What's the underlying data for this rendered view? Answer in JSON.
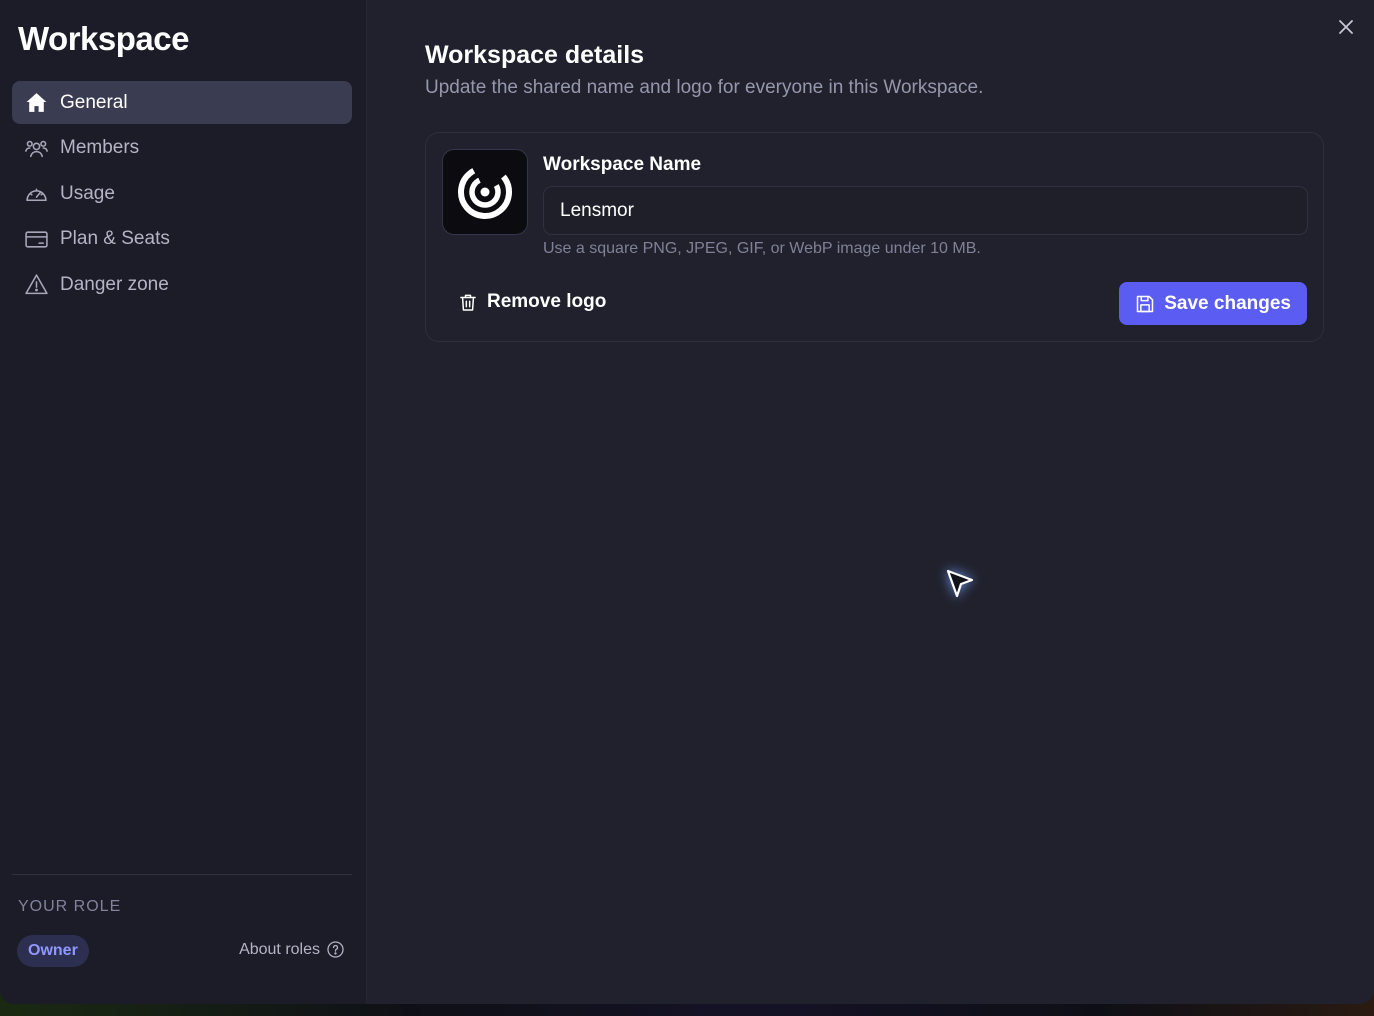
{
  "sidebar": {
    "title": "Workspace",
    "items": [
      {
        "label": "General",
        "icon": "home-icon",
        "active": true
      },
      {
        "label": "Members",
        "icon": "members-icon",
        "active": false
      },
      {
        "label": "Usage",
        "icon": "gauge-icon",
        "active": false
      },
      {
        "label": "Plan & Seats",
        "icon": "credit-card-icon",
        "active": false
      },
      {
        "label": "Danger zone",
        "icon": "warning-icon",
        "active": false
      }
    ],
    "role": {
      "label": "YOUR ROLE",
      "value": "Owner",
      "about_label": "About roles"
    }
  },
  "main": {
    "title": "Workspace details",
    "subtitle": "Update the shared name and logo for everyone in this Workspace.",
    "card": {
      "field_label": "Workspace Name",
      "name_value": "Lensmor",
      "hint": "Use a square PNG, JPEG, GIF, or WebP image under 10 MB.",
      "remove_logo_label": "Remove logo",
      "save_label": "Save changes"
    }
  },
  "colors": {
    "accent": "#5a5cf2",
    "background": "#20212c",
    "sidebar": "#1b1c27",
    "active_item": "#3a3c52",
    "badge_text": "#8f98ff"
  }
}
